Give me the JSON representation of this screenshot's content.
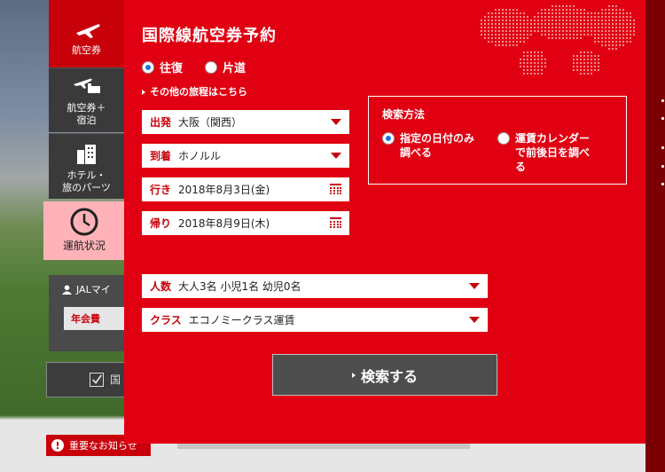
{
  "tabs": {
    "flight": "航空券",
    "flight_hotel_line1": "航空券＋",
    "flight_hotel_line2": "宿泊",
    "hotel_line1": "ホテル・",
    "hotel_line2": "旅のパーツ",
    "status": "運航状況"
  },
  "title": "国際線航空券予約",
  "trip_type": {
    "round_trip": "往復",
    "one_way": "片道",
    "selected": "往復"
  },
  "other_itinerary_link": "その他の旅程はこちら",
  "fields": {
    "departure_label": "出発",
    "departure_value": "大阪（関西）",
    "arrival_label": "到着",
    "arrival_value": "ホノルル",
    "outbound_label": "行き",
    "outbound_value": "2018年8月3日(金)",
    "return_label": "帰り",
    "return_value": "2018年8月9日(木)",
    "passengers_label": "人数",
    "passengers_value": "大人3名 小児1名 幼児0名",
    "class_label": "クラス",
    "class_value": "エコノミークラス運賃"
  },
  "search_method": {
    "title": "検索方法",
    "option1_line1": "指定の日付のみ",
    "option1_line2": "調べる",
    "option2_line1": "運賃カレンダー",
    "option2_line2": "で前後日を調べ",
    "option2_line3": "る",
    "selected": "指定の日付のみ調べる"
  },
  "search_button": "検索する",
  "background": {
    "jal_label": "JALマイ",
    "nenkai_label": "年会費",
    "check_label": "国",
    "notice_label": "重要なお知らせ"
  },
  "colors": {
    "panel_red": "#e10012",
    "label_red": "#c8000a",
    "dark_tab": "#3a3a3a",
    "status_tab": "#ffb3b8"
  }
}
